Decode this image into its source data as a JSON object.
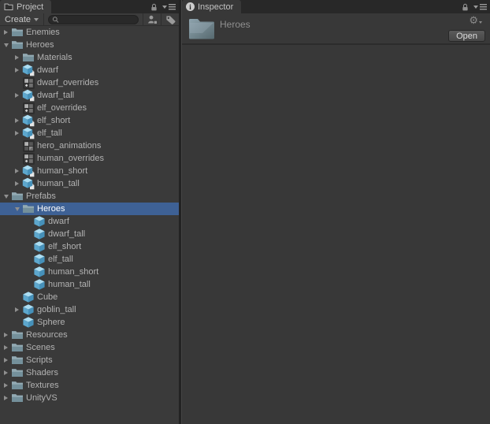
{
  "project_panel": {
    "tab_label": "Project",
    "toolbar": {
      "create_label": "Create",
      "search_value": "",
      "search_placeholder": "",
      "buttons": [
        {
          "icon": "search-by-type"
        },
        {
          "icon": "search-by-label"
        }
      ]
    },
    "tree": [
      {
        "label": "Enemies",
        "icon": "folder",
        "level": 0,
        "arrow": "collapsed"
      },
      {
        "label": "Heroes",
        "icon": "folder",
        "level": 0,
        "arrow": "expanded"
      },
      {
        "label": "Materials",
        "icon": "folder",
        "level": 1,
        "arrow": "collapsed"
      },
      {
        "label": "dwarf",
        "icon": "model",
        "level": 1,
        "arrow": "collapsed"
      },
      {
        "label": "dwarf_overrides",
        "icon": "override",
        "level": 1,
        "arrow": "none"
      },
      {
        "label": "dwarf_tall",
        "icon": "model",
        "level": 1,
        "arrow": "collapsed"
      },
      {
        "label": "elf_overrides",
        "icon": "override",
        "level": 1,
        "arrow": "none"
      },
      {
        "label": "elf_short",
        "icon": "model",
        "level": 1,
        "arrow": "collapsed"
      },
      {
        "label": "elf_tall",
        "icon": "model",
        "level": 1,
        "arrow": "collapsed"
      },
      {
        "label": "hero_animations",
        "icon": "animator",
        "level": 1,
        "arrow": "none"
      },
      {
        "label": "human_overrides",
        "icon": "override",
        "level": 1,
        "arrow": "none"
      },
      {
        "label": "human_short",
        "icon": "model",
        "level": 1,
        "arrow": "collapsed"
      },
      {
        "label": "human_tall",
        "icon": "model",
        "level": 1,
        "arrow": "collapsed"
      },
      {
        "label": "Prefabs",
        "icon": "folder",
        "level": 0,
        "arrow": "expanded"
      },
      {
        "label": "Heroes",
        "icon": "folder",
        "level": 1,
        "arrow": "expanded",
        "selected": true
      },
      {
        "label": "dwarf",
        "icon": "prefab",
        "level": 2,
        "arrow": "none"
      },
      {
        "label": "dwarf_tall",
        "icon": "prefab",
        "level": 2,
        "arrow": "none"
      },
      {
        "label": "elf_short",
        "icon": "prefab",
        "level": 2,
        "arrow": "none"
      },
      {
        "label": "elf_tall",
        "icon": "prefab",
        "level": 2,
        "arrow": "none"
      },
      {
        "label": "human_short",
        "icon": "prefab",
        "level": 2,
        "arrow": "none"
      },
      {
        "label": "human_tall",
        "icon": "prefab",
        "level": 2,
        "arrow": "none"
      },
      {
        "label": "Cube",
        "icon": "prefab",
        "level": 1,
        "arrow": "none"
      },
      {
        "label": "goblin_tall",
        "icon": "prefab",
        "level": 1,
        "arrow": "collapsed"
      },
      {
        "label": "Sphere",
        "icon": "prefab",
        "level": 1,
        "arrow": "none"
      },
      {
        "label": "Resources",
        "icon": "folder",
        "level": 0,
        "arrow": "collapsed"
      },
      {
        "label": "Scenes",
        "icon": "folder",
        "level": 0,
        "arrow": "collapsed"
      },
      {
        "label": "Scripts",
        "icon": "folder",
        "level": 0,
        "arrow": "collapsed"
      },
      {
        "label": "Shaders",
        "icon": "folder",
        "level": 0,
        "arrow": "collapsed"
      },
      {
        "label": "Textures",
        "icon": "folder",
        "level": 0,
        "arrow": "collapsed"
      },
      {
        "label": "UnityVS",
        "icon": "folder",
        "level": 0,
        "arrow": "collapsed"
      }
    ]
  },
  "inspector_panel": {
    "tab_label": "Inspector",
    "header": {
      "title": "Heroes",
      "open_button_label": "Open"
    }
  },
  "colors": {
    "selection": "#3e6195",
    "panel_bg": "#3a3a3a",
    "tabbar_bg": "#282828",
    "text": "#b2b2b2",
    "prefab_cube": "#61aacf",
    "folder": "#7d929c"
  }
}
